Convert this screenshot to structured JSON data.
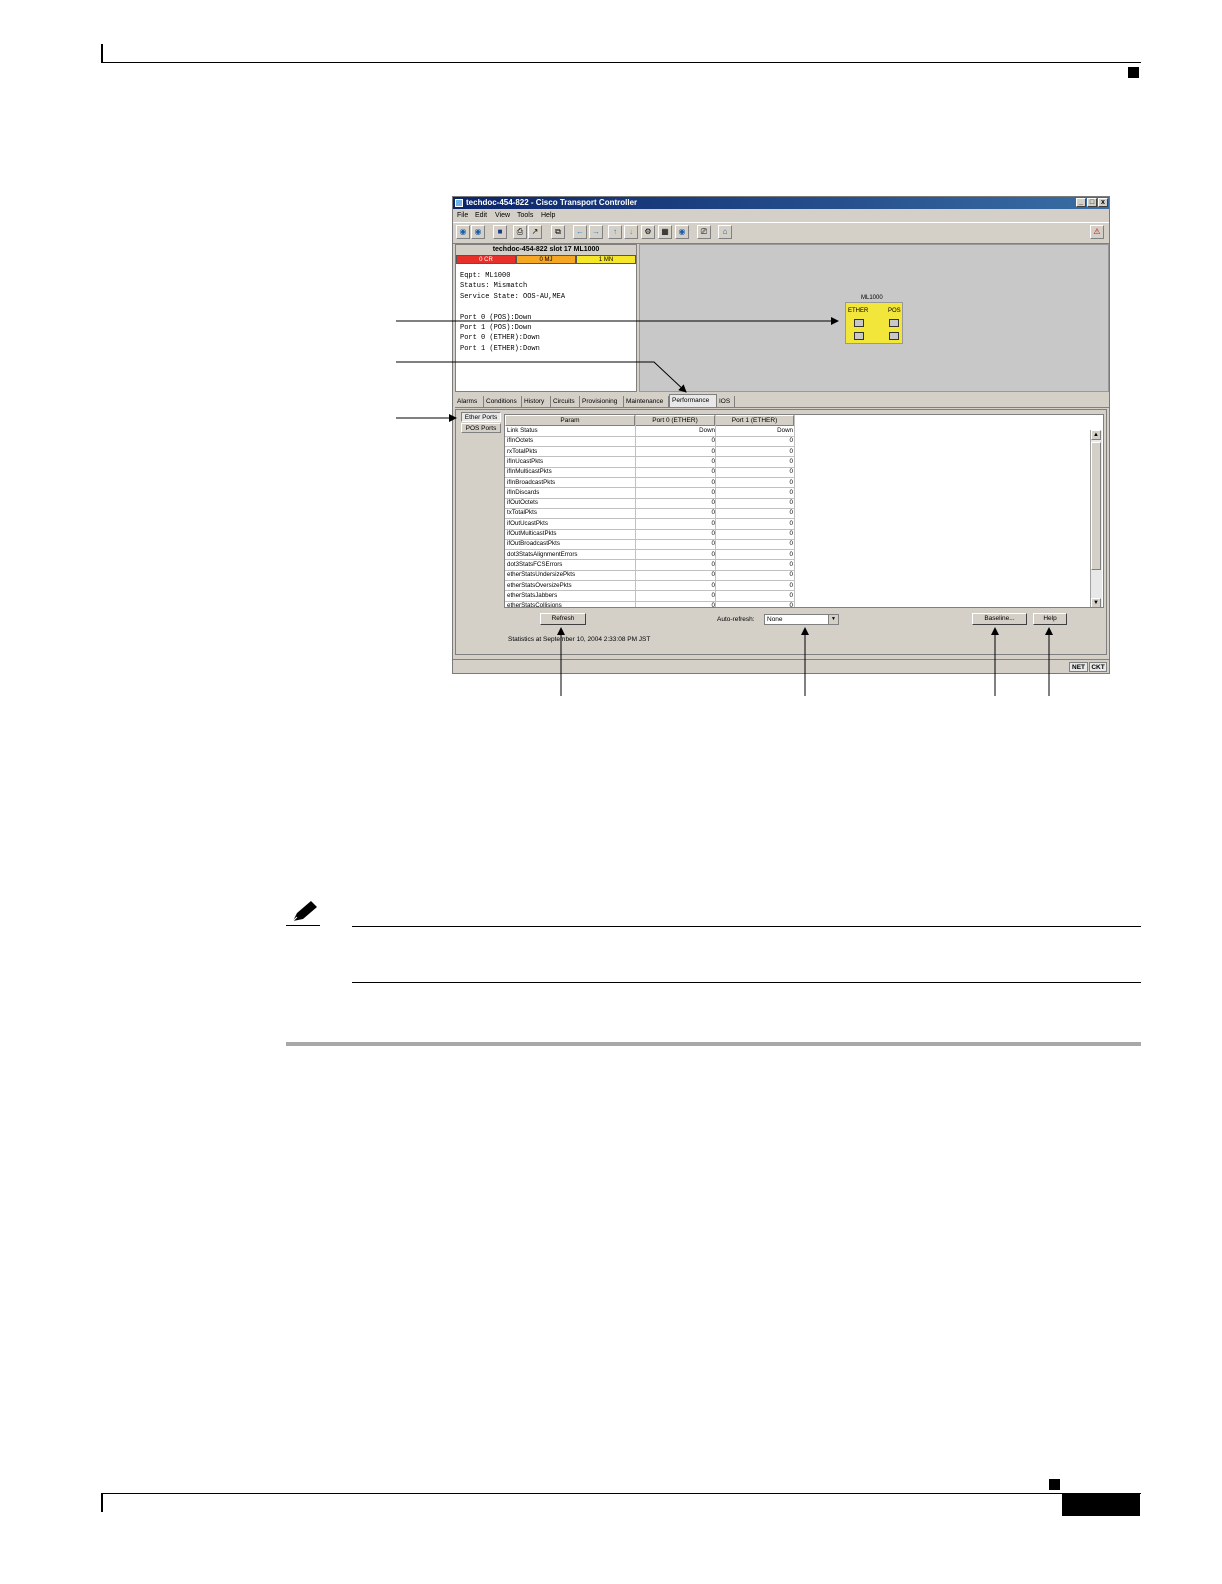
{
  "window": {
    "title": "techdoc-454-822 - Cisco Transport Controller",
    "menu": [
      "File",
      "Edit",
      "View",
      "Tools",
      "Help"
    ],
    "controls": {
      "minimize": "_",
      "restore": "̸̲",
      "close": "x"
    },
    "toolbar_icons": [
      "open-node-icon",
      "home-icon",
      "lock-icon",
      "print-icon",
      "export-icon",
      "copy-icon",
      "back-arrow-icon",
      "forward-arrow-icon",
      "up-arrow-icon",
      "down-arrow-icon",
      "network-view-icon",
      "circuit-icon",
      "help-globe-icon",
      "save-icon",
      "inventory-icon",
      "alert-icon"
    ]
  },
  "card_info": {
    "header": "techdoc-454-822 slot 17 ML1000",
    "alarms": [
      {
        "label": "0 CR",
        "color": "#e8302a"
      },
      {
        "label": "0 MJ",
        "color": "#f5a623"
      },
      {
        "label": "1 MN",
        "color": "#f5e62a"
      }
    ],
    "details": "Eqpt: ML1000\nStatus: Mismatch\nService State: OOS-AU,MEA\n\nPort 0 (POS):Down\nPort 1 (POS):Down\nPort 0 (ETHER):Down\nPort 1 (ETHER):Down"
  },
  "card_graphic": {
    "name": "ML1000",
    "left_label": "ETHER",
    "right_label": "POS",
    "port_labels": [
      "00",
      "00",
      "01",
      "01"
    ],
    "color": "#f2e63a"
  },
  "tabs": [
    "Alarms",
    "Conditions",
    "History",
    "Circuits",
    "Provisioning",
    "Maintenance",
    "Performance",
    "IOS"
  ],
  "active_tab": "Performance",
  "side_buttons": [
    "Ether Ports",
    "POS Ports"
  ],
  "table": {
    "headers": [
      "Param",
      "Port 0 (ETHER)",
      "Port 1 (ETHER)"
    ],
    "rows": [
      [
        "Link Status",
        "Down",
        "Down"
      ],
      [
        "ifInOctets",
        "0",
        "0"
      ],
      [
        "rxTotalPkts",
        "0",
        "0"
      ],
      [
        "ifInUcastPkts",
        "0",
        "0"
      ],
      [
        "ifInMulticastPkts",
        "0",
        "0"
      ],
      [
        "ifInBroadcastPkts",
        "0",
        "0"
      ],
      [
        "ifInDiscards",
        "0",
        "0"
      ],
      [
        "ifOutOctets",
        "0",
        "0"
      ],
      [
        "txTotalPkts",
        "0",
        "0"
      ],
      [
        "ifOutUcastPkts",
        "0",
        "0"
      ],
      [
        "ifOutMulticastPkts",
        "0",
        "0"
      ],
      [
        "ifOutBroadcastPkts",
        "0",
        "0"
      ],
      [
        "dot3StatsAlignmentErrors",
        "0",
        "0"
      ],
      [
        "dot3StatsFCSErrors",
        "0",
        "0"
      ],
      [
        "etherStatsUndersizePkts",
        "0",
        "0"
      ],
      [
        "etherStatsOversizePkts",
        "0",
        "0"
      ],
      [
        "etherStatsJabbers",
        "0",
        "0"
      ],
      [
        "etherStatsCollisions",
        "0",
        "0"
      ]
    ]
  },
  "controls": {
    "refresh": "Refresh",
    "auto_refresh_label": "Auto-refresh:",
    "auto_refresh_value": "None",
    "baseline": "Baseline...",
    "help": "Help",
    "statistics_text": "Statistics at September 10, 2004 2:33:08 PM JST"
  },
  "status_bar": [
    "NET",
    "CKT"
  ]
}
